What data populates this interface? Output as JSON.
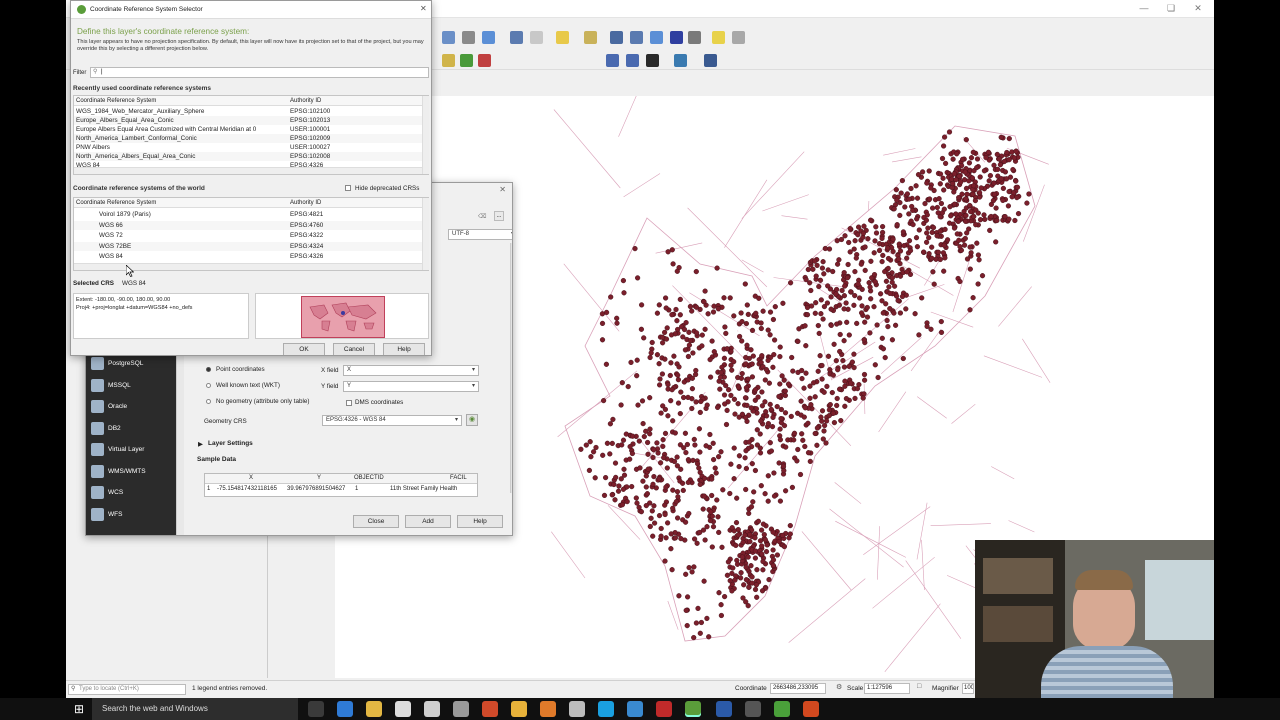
{
  "crs_dialog": {
    "title": "Coordinate Reference System Selector",
    "heading": "Define this layer's coordinate reference system:",
    "description": "This layer appears to have no projection specification. By default, this layer will now have its projection set to that of the project, but you may override this by selecting a different projection below.",
    "filter_label": "Filter",
    "filter_value": "",
    "recent_header": "Recently used coordinate reference systems",
    "col_crs": "Coordinate Reference System",
    "col_authority": "Authority ID",
    "recent_rows": [
      {
        "name": "WGS_1984_Web_Mercator_Auxiliary_Sphere",
        "id": "EPSG:102100"
      },
      {
        "name": "Europe_Albers_Equal_Area_Conic",
        "id": "EPSG:102013"
      },
      {
        "name": "Europe Albers Equal Area Customized with Central Meridian at 0",
        "id": "USER:100001"
      },
      {
        "name": "North_America_Lambert_Conformal_Conic",
        "id": "EPSG:102009"
      },
      {
        "name": "PNW Albers",
        "id": "USER:100027"
      },
      {
        "name": "North_America_Albers_Equal_Area_Conic",
        "id": "EPSG:102008"
      },
      {
        "name": "WGS 84",
        "id": "EPSG:4326"
      }
    ],
    "world_header": "Coordinate reference systems of the world",
    "hide_deprecated": "Hide deprecated CRSs",
    "world_rows": [
      {
        "name": "Voirol 1879 (Paris)",
        "id": "EPSG:4821"
      },
      {
        "name": "WGS 66",
        "id": "EPSG:4760"
      },
      {
        "name": "WGS 72",
        "id": "EPSG:4322"
      },
      {
        "name": "WGS 72BE",
        "id": "EPSG:4324"
      },
      {
        "name": "WGS 84",
        "id": "EPSG:4326"
      }
    ],
    "selected_label": "Selected CRS",
    "selected_value": "WGS 84",
    "extent": "Extent: -180.00, -90.00, 180.00, 90.00",
    "proj4": "Proj4: +proj=longlat +datum=WGS84 +no_defs",
    "ok": "OK",
    "cancel": "Cancel",
    "help": "Help"
  },
  "datasource_dialog": {
    "encoding": "UTF-8",
    "sources": [
      "PostgreSQL",
      "MSSQL",
      "Oracle",
      "DB2",
      "Virtual Layer",
      "WMS/WMTS",
      "WCS",
      "WFS"
    ],
    "point_coordinates": "Point coordinates",
    "wkt": "Well known text (WKT)",
    "no_geometry": "No geometry (attribute only table)",
    "x_field_label": "X field",
    "x_field_value": "X",
    "y_field_label": "Y field",
    "y_field_value": "Y",
    "dms": "DMS coordinates",
    "geometry_crs_label": "Geometry CRS",
    "geometry_crs_value": "EPSG:4326 - WGS 84",
    "layer_settings": "Layer Settings",
    "sample_data": "Sample Data",
    "sample_headers": [
      "X",
      "Y",
      "OBJECTID",
      "FACIL"
    ],
    "sample_row": {
      "num": "1",
      "x": "-75.154817432118165",
      "y": "39.967976891504627",
      "objectid": "1",
      "facil": "11th Street Family Health"
    },
    "close": "Close",
    "add": "Add",
    "help": "Help"
  },
  "statusbar": {
    "locate_placeholder": "Type to locate (Ctrl+K)",
    "message": "1 legend entries removed.",
    "coordinate_label": "Coordinate",
    "coordinate_value": "2663486,233095",
    "scale_label": "Scale",
    "scale_value": "1:127596",
    "magnifier_label": "Magnifier",
    "magnifier_value": "100"
  },
  "taskbar": {
    "search_placeholder": "Search the web and Windows"
  },
  "colors": {
    "point_fill": "#7a1f2b",
    "road_line": "#d9a0b8",
    "qgis_green": "#5a9d3a"
  }
}
